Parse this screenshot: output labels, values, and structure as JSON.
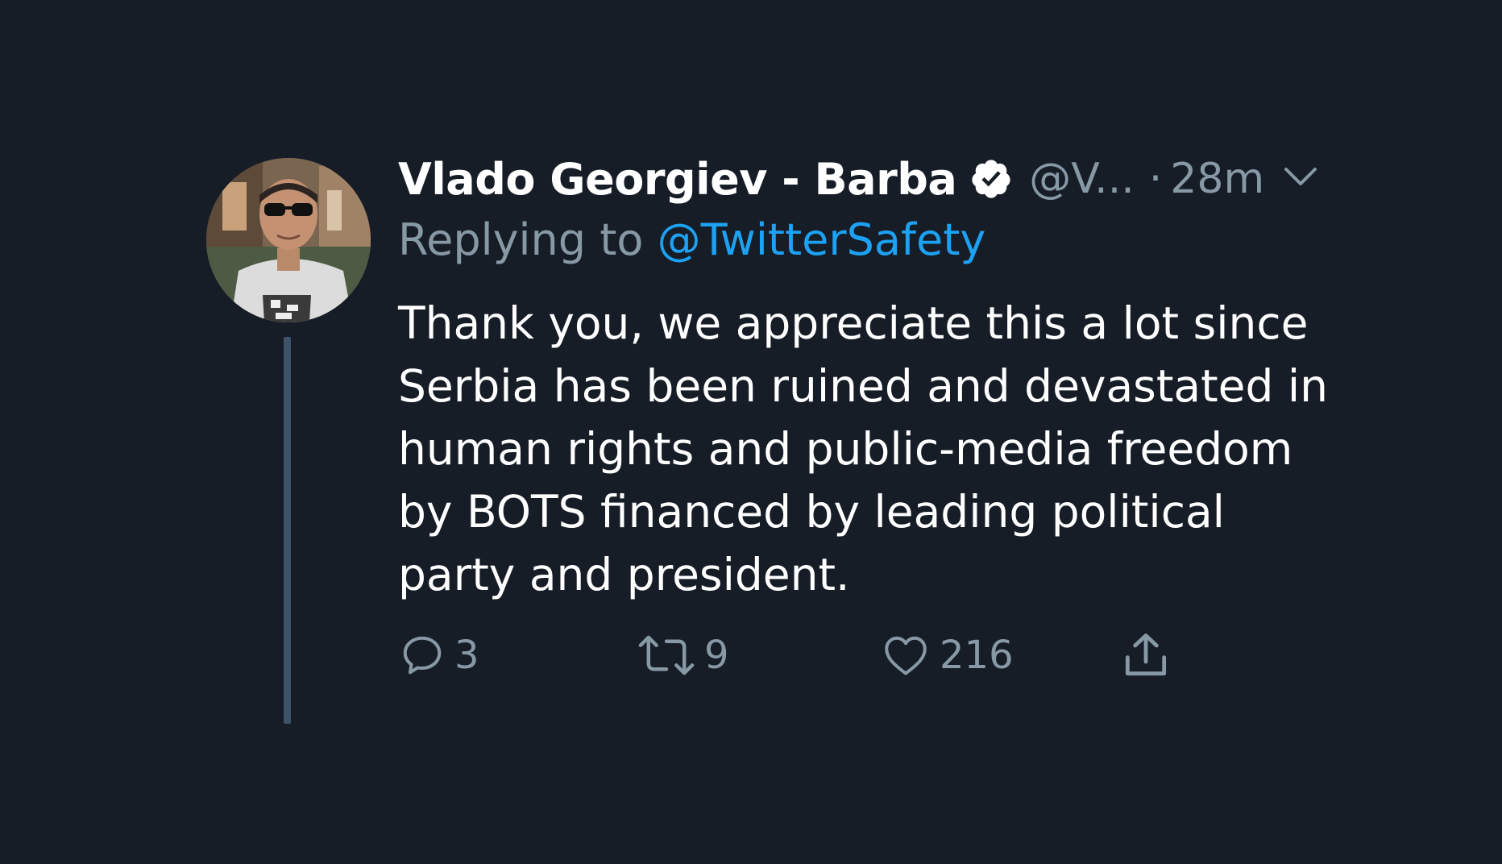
{
  "tweet": {
    "display_name": "Vlado Georgiev - Barba",
    "handle": "@V...",
    "separator": "·",
    "time": "28m",
    "reply_prefix": "Replying to",
    "reply_handle": "@TwitterSafety",
    "body": "Thank you, we appreciate this a lot since\nSerbia has been ruined and devastated in\nhuman rights and public-media freedom\nby BOTS financed by leading political\nparty and president.",
    "icons": {
      "verified": "verified-badge-icon",
      "menu": "chevron-down-icon",
      "reply": "reply-icon",
      "retweet": "retweet-icon",
      "like": "heart-icon",
      "share": "share-icon"
    },
    "actions": {
      "reply_count": "3",
      "retweet_count": "9",
      "like_count": "216"
    },
    "colors": {
      "background": "#161d27",
      "text": "#ffffff",
      "muted": "#8899a6",
      "link": "#1da1f2",
      "thread_line": "#3d5466"
    }
  }
}
